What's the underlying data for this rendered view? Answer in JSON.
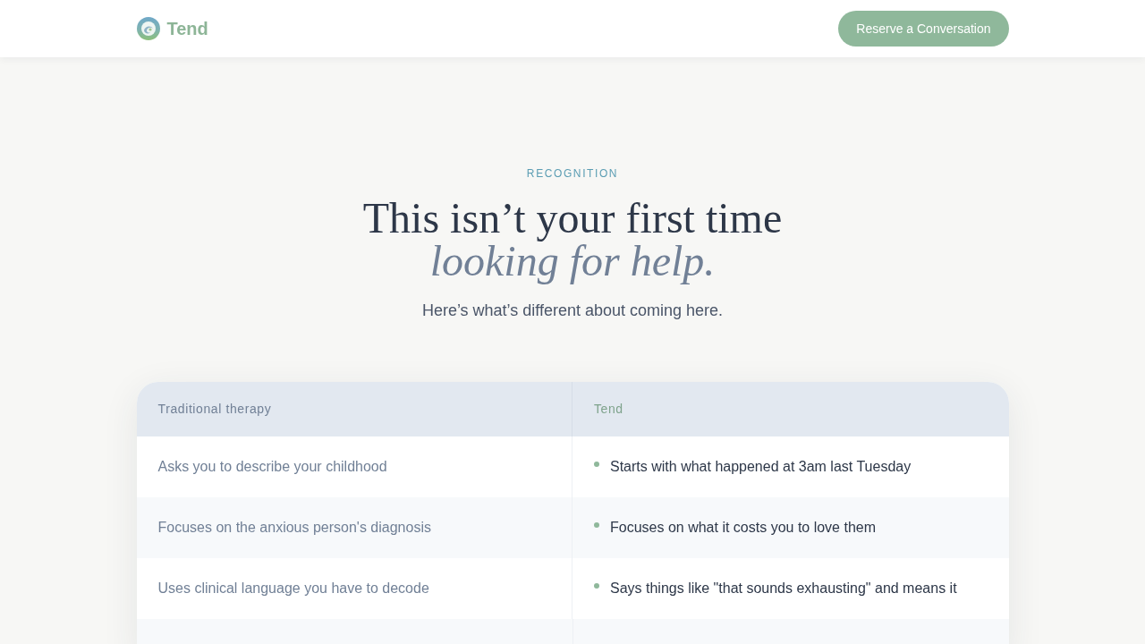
{
  "header": {
    "brand": "Tend",
    "cta": "Reserve a Conversation"
  },
  "hero": {
    "eyebrow": "RECOGNITION",
    "title": "This isn’t your first time",
    "title_emphasis": "looking for help.",
    "subtitle": "Here’s what’s different about coming here."
  },
  "comparison": {
    "columns": [
      "Traditional therapy",
      "Tend"
    ],
    "rows": [
      {
        "traditional": "Asks you to describe your childhood",
        "tend": "Starts with what happened at 3am last Tuesday"
      },
      {
        "traditional": "Focuses on the anxious person's diagnosis",
        "tend": "Focuses on what it costs you to love them"
      },
      {
        "traditional": "Uses clinical language you have to decode",
        "tend": "Says things like \"that sounds exhausting\" and means it"
      }
    ]
  }
}
